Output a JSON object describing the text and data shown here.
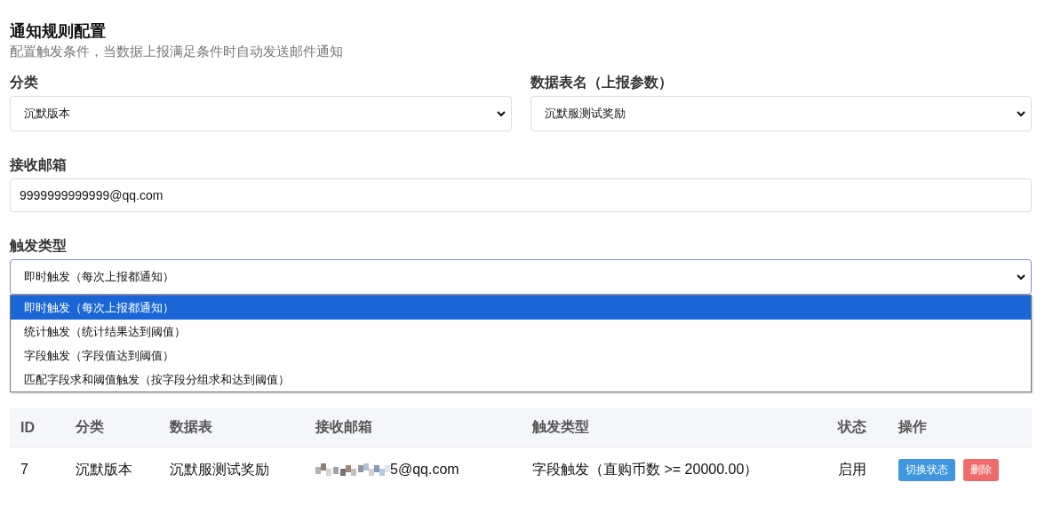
{
  "header": {
    "title": "通知规则配置",
    "subtitle": "配置触发条件，当数据上报满足条件时自动发送邮件通知"
  },
  "category": {
    "label": "分类",
    "value": "沉默版本"
  },
  "table_name": {
    "label": "数据表名（上报参数）",
    "value": "沉默服测试奖励"
  },
  "email": {
    "label": "接收邮箱",
    "value": "9999999999999@qq.com"
  },
  "trigger": {
    "label": "触发类型",
    "value": "即时触发（每次上报都通知）",
    "expanded": true,
    "options": [
      {
        "label": "即时触发（每次上报都通知）",
        "selected": true
      },
      {
        "label": "统计触发（统计结果达到阈值）",
        "selected": false
      },
      {
        "label": "字段触发（字段值达到阈值）",
        "selected": false
      },
      {
        "label": "匹配字段求和阈值触发（按字段分组求和达到阈值）",
        "selected": false
      }
    ]
  },
  "rules": {
    "columns": [
      "ID",
      "分类",
      "数据表",
      "接收邮箱",
      "触发类型",
      "状态",
      "操作"
    ],
    "rows": [
      {
        "id": "7",
        "category": "沉默版本",
        "table": "沉默服测试奖励",
        "email": "5@qq.com",
        "email_redacted": true,
        "trigger": "字段触发（直购币数 >= 20000.00）",
        "status": "启用",
        "actions": [
          {
            "kind": "toggle",
            "label": "切换状态"
          },
          {
            "kind": "delete",
            "label": "删除"
          }
        ]
      }
    ]
  }
}
